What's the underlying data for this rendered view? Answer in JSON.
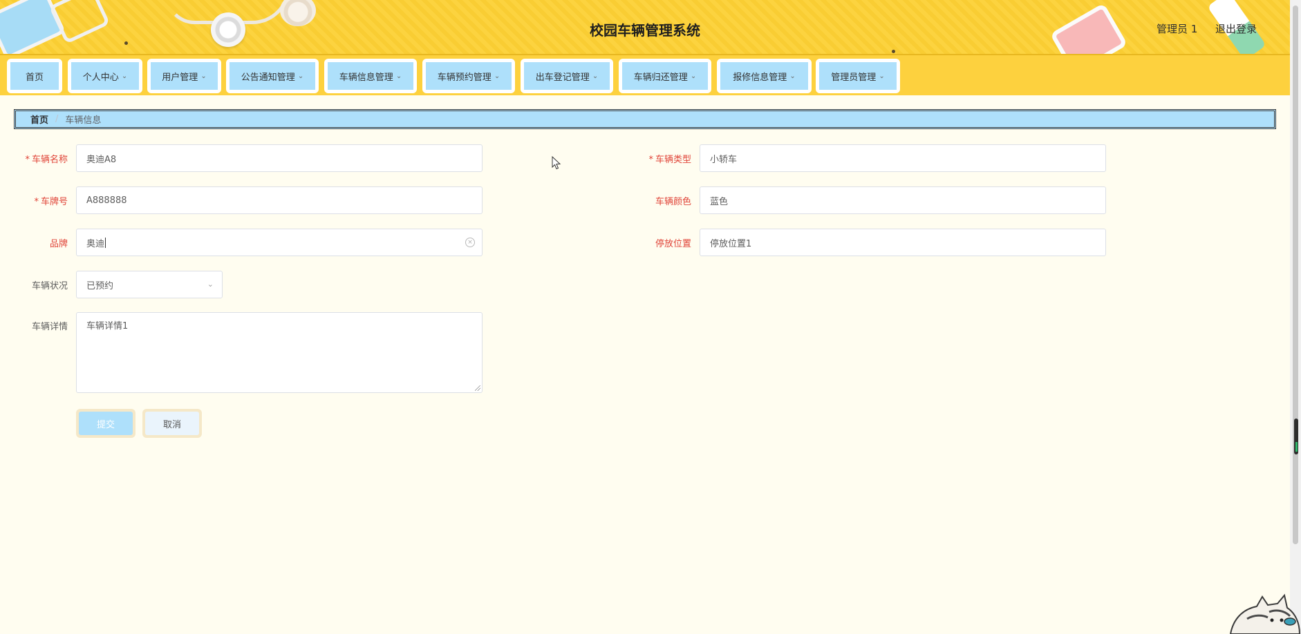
{
  "header": {
    "title": "校园车辆管理系统",
    "user": "管理员 1",
    "logout": "退出登录"
  },
  "nav": [
    {
      "label": "首页",
      "dropdown": false
    },
    {
      "label": "个人中心",
      "dropdown": true
    },
    {
      "label": "用户管理",
      "dropdown": true
    },
    {
      "label": "公告通知管理",
      "dropdown": true
    },
    {
      "label": "车辆信息管理",
      "dropdown": true
    },
    {
      "label": "车辆预约管理",
      "dropdown": true
    },
    {
      "label": "出车登记管理",
      "dropdown": true
    },
    {
      "label": "车辆归还管理",
      "dropdown": true
    },
    {
      "label": "报修信息管理",
      "dropdown": true
    },
    {
      "label": "管理员管理",
      "dropdown": true
    }
  ],
  "breadcrumb": {
    "home": "首页",
    "separator": "/",
    "current": "车辆信息"
  },
  "form": {
    "vehicle_name": {
      "label": "车辆名称",
      "value": "奥迪A8",
      "required": true
    },
    "vehicle_type": {
      "label": "车辆类型",
      "value": "小轿车",
      "required": true
    },
    "plate_number": {
      "label": "车牌号",
      "value": "A888888",
      "required": true
    },
    "vehicle_color": {
      "label": "车辆颜色",
      "value": "蓝色"
    },
    "brand": {
      "label": "品牌",
      "value": "奥迪"
    },
    "parking_location": {
      "label": "停放位置",
      "value": "停放位置1"
    },
    "vehicle_status": {
      "label": "车辆状况",
      "value": "已预约"
    },
    "vehicle_details": {
      "label": "车辆详情",
      "value": "车辆详情1"
    },
    "required_mark": "*",
    "submit": "提交",
    "cancel": "取消"
  },
  "icons": {
    "clear": "circle-x-icon",
    "select": "chevron-down-icon",
    "nav_dropdown": "chevron-down-icon"
  },
  "colors": {
    "header_bg": "#fcd33f",
    "nav_item_bg": "#aee0fb",
    "page_bg": "#fffdf0",
    "label_red": "#e04438"
  }
}
